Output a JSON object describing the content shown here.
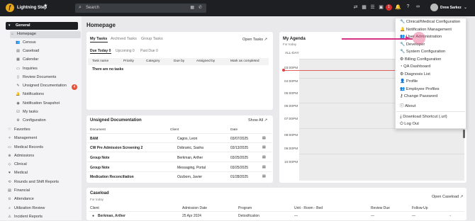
{
  "app": {
    "name": "Lightning Step",
    "search_placeholder": "Search",
    "user": "Drew Sarkez",
    "notif_count": "1"
  },
  "sidebar": {
    "section": "General",
    "items": [
      {
        "label": "Homepage",
        "icon": "home-icon"
      },
      {
        "label": "Census",
        "icon": "users-icon"
      },
      {
        "label": "Caseload",
        "icon": "briefcase-icon"
      },
      {
        "label": "Calendar",
        "icon": "calendar-icon"
      },
      {
        "label": "Inquiries",
        "icon": "inbox-icon"
      },
      {
        "label": "Review Documents",
        "icon": "document-icon"
      },
      {
        "label": "Unsigned Documentation",
        "icon": "pen-icon",
        "badge": "4"
      },
      {
        "label": "Notifications",
        "icon": "bell-icon"
      },
      {
        "label": "Notification Snapshot",
        "icon": "camera-icon"
      },
      {
        "label": "My tasks",
        "icon": "check-icon"
      },
      {
        "label": "Configuration",
        "icon": "cog-icon"
      }
    ],
    "groups": [
      "Favorites",
      "Management",
      "Medical Records",
      "Admissions",
      "Clinical",
      "Medical",
      "Rounds and Shift Reports",
      "Financial",
      "Attendance",
      "Utilization Review",
      "Incident Reports"
    ]
  },
  "page": {
    "title": "Homepage"
  },
  "tasks": {
    "tabs": [
      "My Tasks",
      "Archived Tasks",
      "Group Tasks"
    ],
    "open_link": "Open Tasks",
    "filters": [
      "Due Today 0",
      "Upcoming 0",
      "Past Due 0"
    ],
    "columns": [
      "Task name",
      "Priority",
      "Category",
      "Due by",
      "Assigned by",
      "Mark as completed"
    ],
    "empty": "There are no tasks"
  },
  "unsigned": {
    "title": "Unsigned Documentation",
    "show_all": "Show All",
    "columns": [
      "Document",
      "Client",
      "Date"
    ],
    "rows": [
      {
        "doc": "BAM",
        "client": "Cagos, Leon",
        "date": "03/07/2025"
      },
      {
        "doc": "CW Pre Admission Screening 2",
        "client": "Dobranic, Sasha",
        "date": "03/13/2025"
      },
      {
        "doc": "Group Note",
        "client": "Berkman, Arther",
        "date": "03/25/2025"
      },
      {
        "doc": "Group Note",
        "client": "Messaging, Portal",
        "date": "03/25/2025"
      },
      {
        "doc": "Medication Reconciliation",
        "client": "Ozzborn, Javier",
        "date": "01/28/2025"
      }
    ]
  },
  "agenda": {
    "title": "My Agenda",
    "subtitle": "For today",
    "allday": "ALL-DAY",
    "times": [
      "03:00PM",
      "04:00PM",
      "05:00PM",
      "06:00PM",
      "07:00PM",
      "08:00PM",
      "09:00PM",
      "10:00PM"
    ]
  },
  "caseload": {
    "title": "Caseload",
    "subtitle": "For today",
    "open_link": "Open Caseload",
    "columns": [
      "Client",
      "Admission Date",
      "Program",
      "Unit - Room - Bed",
      "Review Due",
      "Follow-Up"
    ],
    "row": {
      "client": "Berkman, Arther",
      "admission": "25 Apr 2024",
      "program": "Detoxification",
      "unit": "—",
      "review": "—",
      "followup": "—"
    }
  },
  "menu": {
    "items": [
      {
        "label": "Clinical/Medical Configuration",
        "icon": "wrench-icon"
      },
      {
        "label": "Notification Management",
        "icon": "bell-icon"
      },
      {
        "label": "User Administration",
        "icon": "users-cog-icon"
      },
      {
        "label": "Developer",
        "icon": "wrench-icon"
      },
      {
        "label": "System Configuration",
        "icon": "wrench-icon"
      },
      {
        "label": "Billing Configuration",
        "icon": "cogs-icon"
      },
      {
        "label": "QA Dashboard",
        "icon": "dashboard-icon"
      },
      {
        "label": "Diagnosis List",
        "icon": "gear-icon"
      },
      {
        "label": "Profile",
        "icon": "user-icon"
      },
      {
        "label": "Employee Profiles",
        "icon": "users-icon"
      },
      {
        "label": "Change Password",
        "icon": "key-icon"
      },
      {
        "label": "About",
        "icon": "info-icon"
      }
    ],
    "footer": [
      {
        "label": "Download Shortcut (.url)",
        "icon": "download-icon"
      },
      {
        "label": "Log Out",
        "icon": "power-icon"
      }
    ]
  }
}
